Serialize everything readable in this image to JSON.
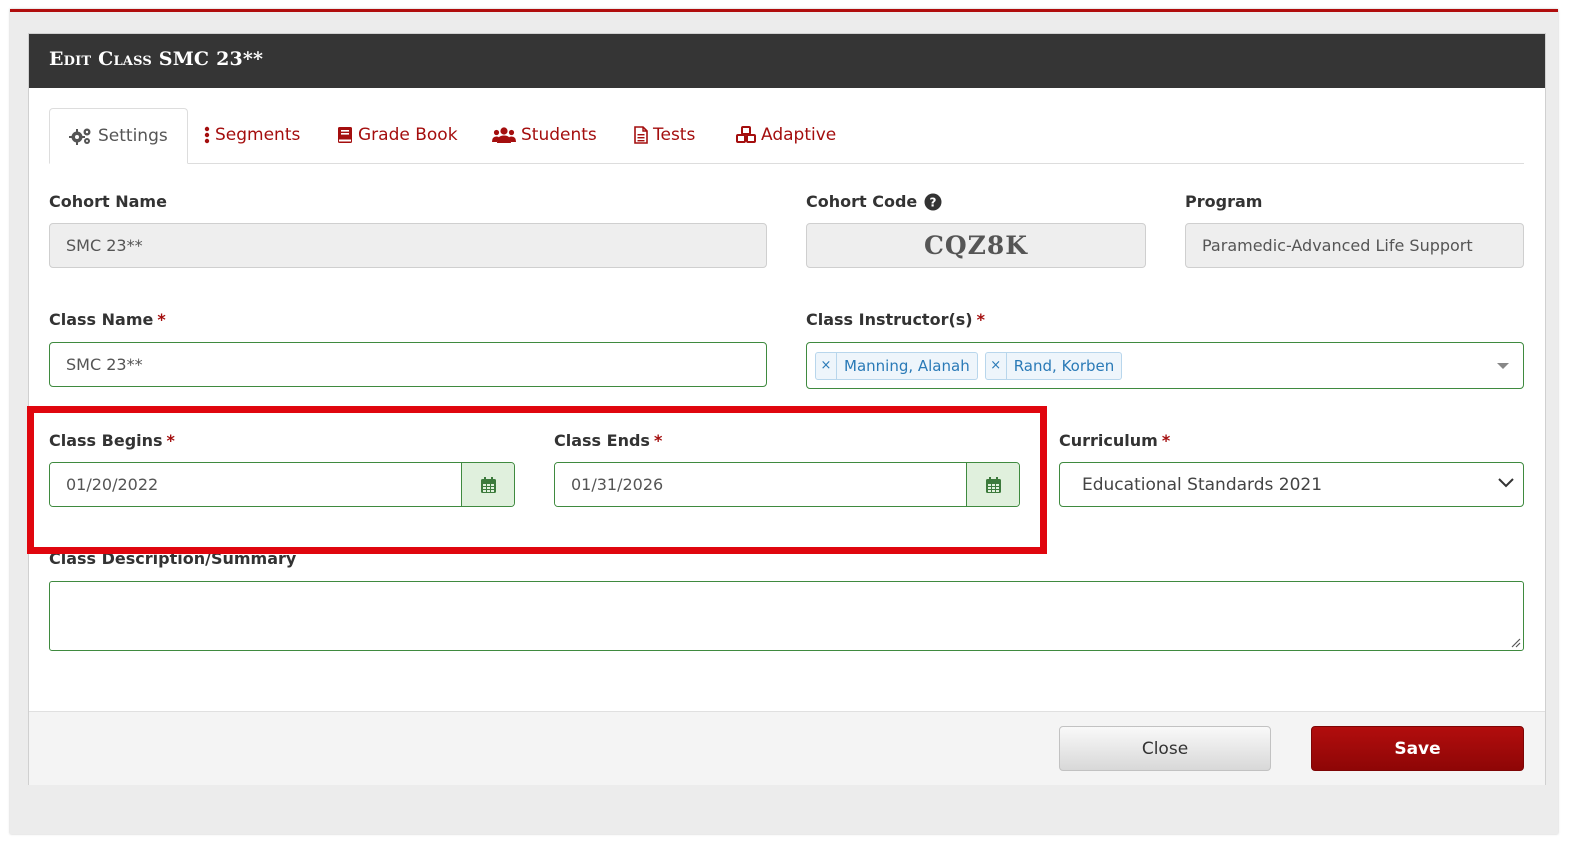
{
  "modal": {
    "title": "Edit Class SMC 23**"
  },
  "tabs": [
    {
      "label": "Settings",
      "icon": "gears-icon",
      "active": true
    },
    {
      "label": "Segments",
      "icon": "ellipsis-vertical-icon"
    },
    {
      "label": "Grade Book",
      "icon": "book-icon"
    },
    {
      "label": "Students",
      "icon": "users-icon"
    },
    {
      "label": "Tests",
      "icon": "file-text-icon"
    },
    {
      "label": "Adaptive",
      "icon": "cubes-icon"
    }
  ],
  "fields": {
    "cohort_name": {
      "label": "Cohort Name",
      "value": "SMC 23**"
    },
    "cohort_code": {
      "label": "Cohort Code",
      "value": "CQZ8K",
      "help_icon": "question-circle-icon"
    },
    "program": {
      "label": "Program",
      "value": "Paramedic-Advanced Life Support"
    },
    "class_name": {
      "label": "Class Name",
      "required": "*",
      "value": "SMC 23**"
    },
    "class_instructors": {
      "label": "Class Instructor(s)",
      "required": "*",
      "tags": [
        {
          "remove": "×",
          "name": "Manning, Alanah"
        },
        {
          "remove": "×",
          "name": "Rand, Korben"
        }
      ]
    },
    "class_begins": {
      "label": "Class Begins",
      "required": "*",
      "value": "01/20/2022",
      "icon": "calendar-icon"
    },
    "class_ends": {
      "label": "Class Ends",
      "required": "*",
      "value": "01/31/2026",
      "icon": "calendar-icon"
    },
    "curriculum": {
      "label": "Curriculum",
      "required": "*",
      "value": "Educational Standards 2021"
    },
    "description": {
      "label": "Class Description/Summary",
      "value": ""
    }
  },
  "footer": {
    "close_label": "Close",
    "save_label": "Save"
  },
  "colors": {
    "accent": "#a40e0e",
    "header_bg": "#353535",
    "input_border": "#3f8a3f",
    "highlight": "#e0060e"
  }
}
